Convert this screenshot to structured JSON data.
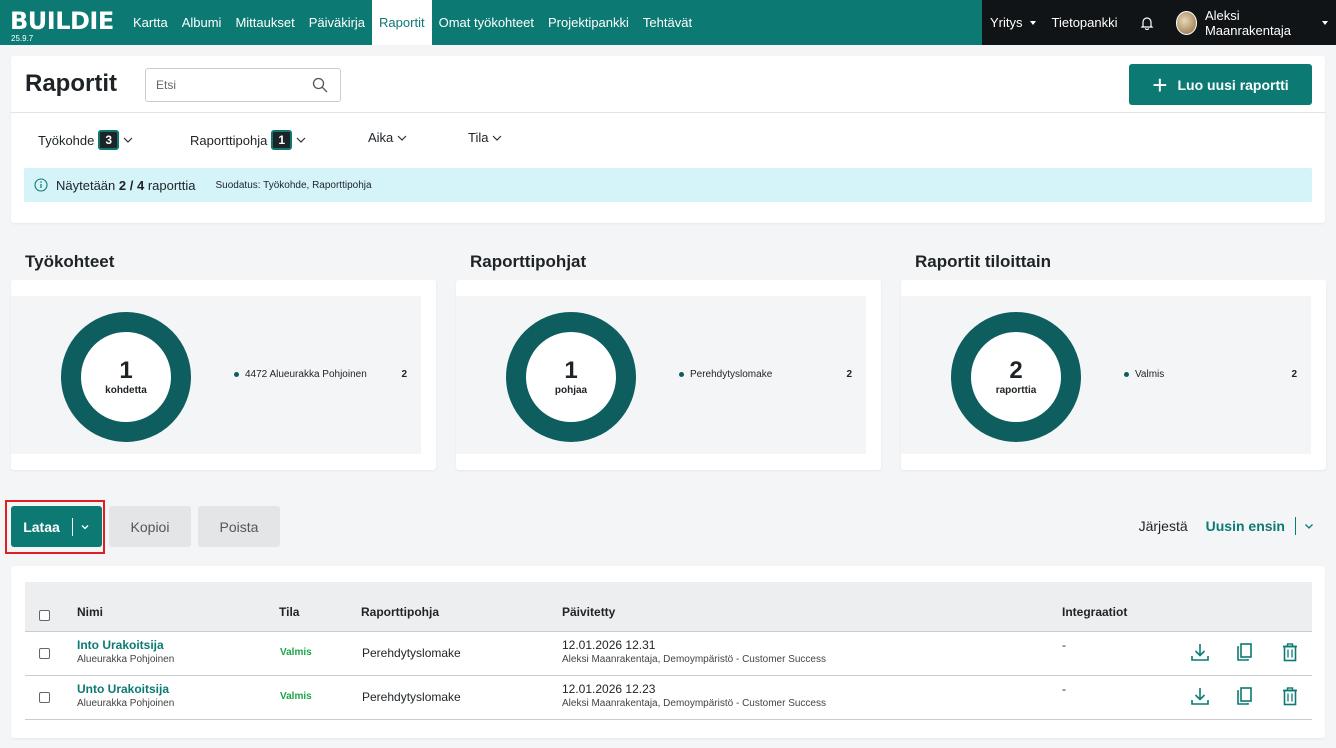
{
  "app": {
    "brand": "BUILDIE",
    "version": "25.9.7"
  },
  "nav": {
    "items": [
      "Kartta",
      "Albumi",
      "Mittaukset",
      "Päiväkirja",
      "Raportit",
      "Omat työkohteet",
      "Projektipankki",
      "Tehtävät"
    ],
    "active": "Raportit",
    "company": "Yritys",
    "knowledge": "Tietopankki",
    "user": "Aleksi Maanrakentaja"
  },
  "header": {
    "title": "Raportit",
    "search_placeholder": "Etsi",
    "new_button": "Luo uusi raportti"
  },
  "filters": [
    {
      "label": "Työkohde",
      "count": "3"
    },
    {
      "label": "Raporttipohja",
      "count": "1"
    },
    {
      "label": "Aika",
      "count": ""
    },
    {
      "label": "Tila",
      "count": ""
    }
  ],
  "info": {
    "prefix": "Näytetään",
    "shown": "2 / 4",
    "suffix": "raporttia",
    "filter_note": "Suodatus: Työkohde, Raporttipohja"
  },
  "stats": [
    {
      "title": "Työkohteet",
      "number": "1",
      "unit": "kohdetta",
      "legend": "4472 Alueurakka Pohjoinen",
      "count": "2"
    },
    {
      "title": "Raporttipohjat",
      "number": "1",
      "unit": "pohjaa",
      "legend": "Perehdytyslomake",
      "count": "2"
    },
    {
      "title": "Raportit tiloittain",
      "number": "2",
      "unit": "raporttia",
      "legend": "Valmis",
      "count": "2"
    }
  ],
  "actions": {
    "download": "Lataa",
    "copy": "Kopioi",
    "delete": "Poista"
  },
  "sort": {
    "label": "Järjestä",
    "value": "Uusin ensin"
  },
  "table": {
    "columns": {
      "name": "Nimi",
      "status": "Tila",
      "template": "Raporttipohja",
      "updated": "Päivitetty",
      "integrations": "Integraatiot"
    },
    "rows": [
      {
        "name": "Into Urakoitsija",
        "site": "Alueurakka Pohjoinen",
        "status": "Valmis",
        "template": "Perehdytyslomake",
        "date": "12.01.2026 12.31",
        "by": "Aleksi Maanrakentaja, Demoympäristö - Customer Success",
        "integrations": "-"
      },
      {
        "name": "Unto Urakoitsija",
        "site": "Alueurakka Pohjoinen",
        "status": "Valmis",
        "template": "Perehdytyslomake",
        "date": "12.01.2026 12.23",
        "by": "Aleksi Maanrakentaja, Demoympäristö - Customer Success",
        "integrations": "-"
      }
    ]
  },
  "colors": {
    "primary": "#0c7a73",
    "donut": "#0f5e5f",
    "status_ok": "#1fa34a",
    "info_bg": "#d5f4fa",
    "highlight": "#e02020"
  }
}
